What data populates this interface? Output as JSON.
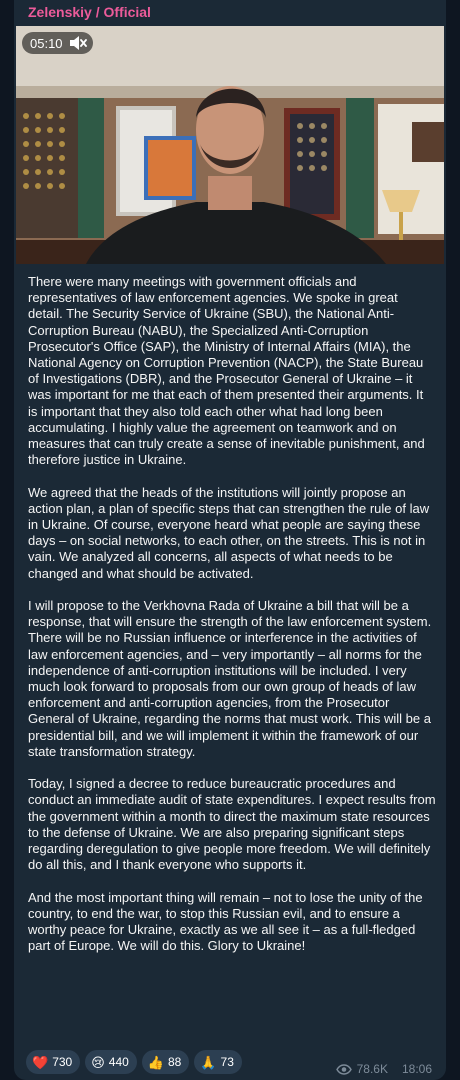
{
  "post": {
    "channel_name": "Zelenskiy / Official",
    "video": {
      "duration": "05:10",
      "muted_icon": "speaker-muted-icon"
    },
    "paragraphs": [
      "There were many meetings with government officials and representatives of law enforcement agencies. We spoke in great detail. The Security Service of Ukraine (SBU), the National Anti-Corruption Bureau (NABU), the Specialized Anti-Corruption Prosecutor's Office (SAP), the Ministry of Internal Affairs (MIA), the National Agency on Corruption Prevention (NACP), the State Bureau of Investigations (DBR), and the Prosecutor General of Ukraine – it was important for me that each of them presented their arguments. It is important that they also told each other what had long been accumulating. I highly value the agreement on teamwork and on measures that can truly create a sense of inevitable punishment, and therefore justice in Ukraine.",
      "We agreed that the heads of the institutions will jointly propose an action plan, a plan of specific steps that can strengthen the rule of law in Ukraine. Of course, everyone heard what people are saying these days – on social networks, to each other, on the streets. This is not in vain. We analyzed all concerns, all aspects of what needs to be changed and what should be activated.",
      "I will propose to the Verkhovna Rada of Ukraine a bill that will be a response, that will ensure the strength of the law enforcement system. There will be no Russian influence or interference in the activities of law enforcement agencies, and – very importantly – all norms for the independence of anti-corruption institutions will be included. I very much look forward to proposals from our own group of heads of law enforcement and anti-corruption agencies, from the Prosecutor General of Ukraine, regarding the norms that must work. This will be a presidential bill, and we will implement it within the framework of our state transformation strategy.",
      "Today, I signed a decree to reduce bureaucratic procedures and conduct an immediate audit of state expenditures. I expect results from the government within a month to direct the maximum state resources to the defense of Ukraine. We are also preparing significant steps regarding deregulation to give people more freedom. We will definitely do all this, and I thank everyone who supports it.",
      "And the most important thing will remain – not to lose the unity of the country, to end the war, to stop this Russian evil, and to ensure a worthy peace for Ukraine, exactly as we all see it – as a full-fledged part of Europe. We will do this. Glory to Ukraine!"
    ],
    "reactions": [
      {
        "emoji": "❤️",
        "icon": "heart-icon",
        "count": "730"
      },
      {
        "emoji": "😢",
        "icon": "crying-face-icon",
        "count": "440"
      },
      {
        "emoji": "👍",
        "icon": "thumbs-up-icon",
        "count": "88"
      },
      {
        "emoji": "🙏",
        "icon": "folded-hands-icon",
        "count": "73"
      }
    ],
    "views": "78.6K",
    "time": "18:06"
  },
  "colors": {
    "background": "#0e1621",
    "bubble": "#1b2936",
    "channel_name": "#ec5b9a",
    "text": "#f5f5f5",
    "meta": "#7d8b99",
    "reaction_bg": "#2c3f52"
  }
}
